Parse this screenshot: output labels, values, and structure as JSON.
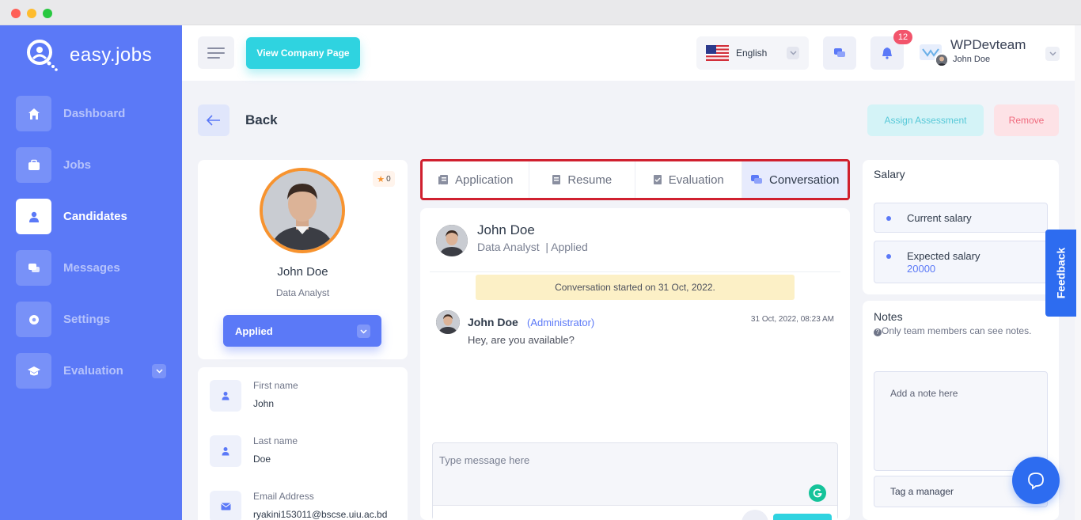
{
  "brand": {
    "name": "easy.jobs"
  },
  "sidebar": {
    "items": [
      {
        "label": "Dashboard",
        "icon": "home-icon"
      },
      {
        "label": "Jobs",
        "icon": "briefcase-icon"
      },
      {
        "label": "Candidates",
        "icon": "user-icon",
        "active": true
      },
      {
        "label": "Messages",
        "icon": "chat-icon"
      },
      {
        "label": "Settings",
        "icon": "gear-icon"
      },
      {
        "label": "Evaluation",
        "icon": "graduation-cap-icon"
      }
    ]
  },
  "topbar": {
    "view_company_label": "View Company Page",
    "language": "English",
    "notification_count": "12",
    "company_name": "WPDevteam",
    "user_name": "John Doe"
  },
  "page": {
    "back_label": "Back",
    "assign_assessment_label": "Assign Assessment",
    "remove_label": "Remove"
  },
  "candidate": {
    "rating": "0",
    "name": "John Doe",
    "role": "Data Analyst",
    "status": "Applied",
    "fields": [
      {
        "label": "First name",
        "value": "John",
        "icon": "user-icon"
      },
      {
        "label": "Last name",
        "value": "Doe",
        "icon": "user-icon"
      },
      {
        "label": "Email Address",
        "value": "ryakini153011@bscse.uiu.ac.bd",
        "icon": "envelope-icon"
      }
    ]
  },
  "tabs": [
    {
      "label": "Application",
      "icon": "document-icon"
    },
    {
      "label": "Resume",
      "icon": "file-icon"
    },
    {
      "label": "Evaluation",
      "icon": "checklist-icon"
    },
    {
      "label": "Conversation",
      "icon": "chat-icon",
      "active": true
    }
  ],
  "conversation": {
    "header_name": "John Doe",
    "header_role": "Data Analyst",
    "header_status": "| Applied",
    "notice": "Conversation started on 31 Oct, 2022.",
    "messages": [
      {
        "author": "John Doe",
        "author_role": "(Administrator)",
        "time": "31 Oct, 2022, 08:23 AM",
        "text": "Hey, are you available?"
      }
    ],
    "input_placeholder": "Type message here"
  },
  "salary": {
    "title": "Salary",
    "current_label": "Current salary",
    "expected_label": "Expected salary",
    "expected_value": "20000"
  },
  "notes": {
    "title": "Notes",
    "help": "Only team members can see notes.",
    "placeholder": "Add a note here",
    "tag_manager_label": "Tag a manager"
  },
  "feedback_label": "Feedback",
  "colors": {
    "primary": "#5b79f7",
    "accent_cyan": "#2fd3e0",
    "danger": "#f06b7e",
    "photo_ring": "#f7932f",
    "tabs_highlight_border": "#d0202f"
  }
}
